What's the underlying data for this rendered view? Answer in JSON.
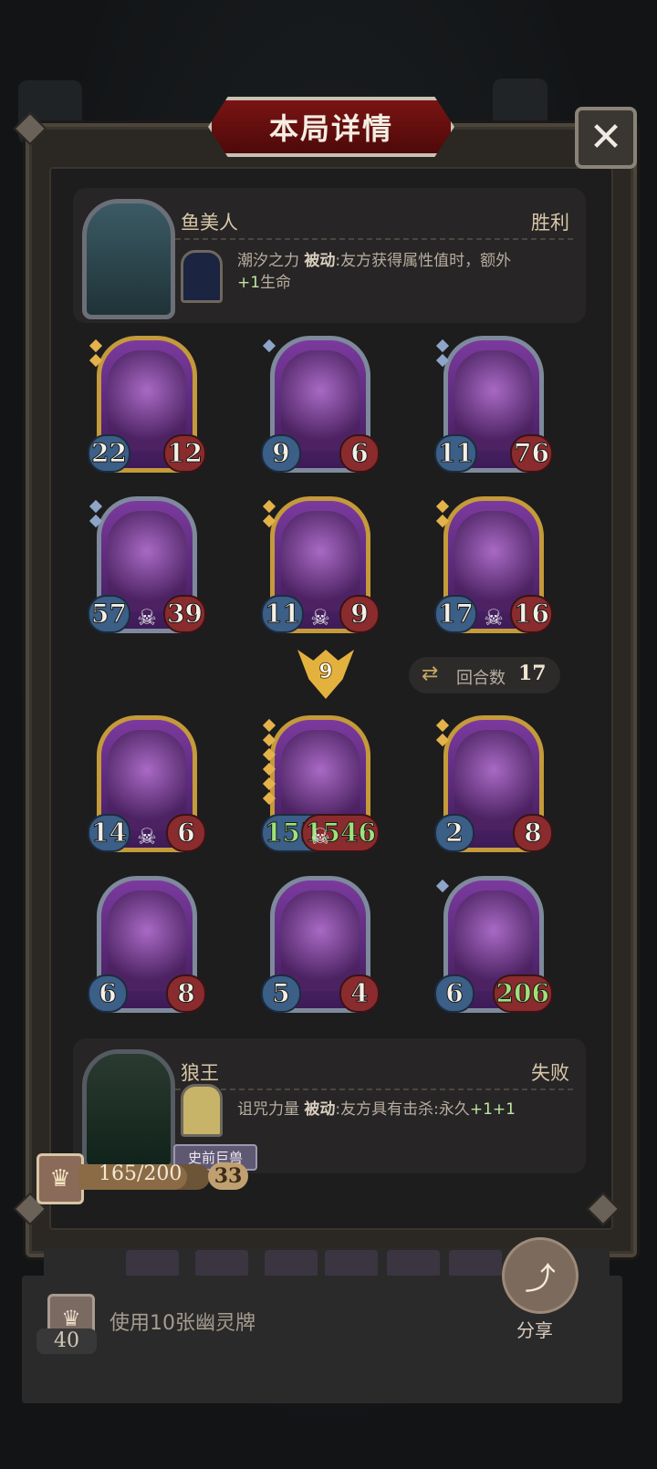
{
  "title": "本局详情",
  "close_label": "✕",
  "winner": {
    "name": "鱼美人",
    "result": "胜利",
    "skill_name": "潮汐之力",
    "skill_type": "被动",
    "skill_desc": ":友方获得属性值时，额外",
    "skill_desc2_bonus": "+1",
    "skill_desc2": "生命"
  },
  "loser": {
    "name": "狼王",
    "result": "失败",
    "skill_name": "诅咒力量",
    "skill_type": "被动",
    "skill_desc": ":友方具有击杀:永久",
    "skill_bonus": "+1+1",
    "tag": "史前巨兽"
  },
  "winner_board": [
    {
      "atk": "22",
      "hp": "12",
      "skull": false,
      "frame": "gold",
      "pips": 2
    },
    {
      "atk": "9",
      "hp": "6",
      "skull": false,
      "frame": "silver",
      "pips": 1
    },
    {
      "atk": "11",
      "hp": "76",
      "skull": false,
      "frame": "silver",
      "pips": 2
    },
    {
      "atk": "57",
      "hp": "39",
      "skull": true,
      "frame": "silver",
      "pips": 2
    },
    {
      "atk": "11",
      "hp": "9",
      "skull": true,
      "frame": "gold",
      "pips": 2
    },
    {
      "atk": "17",
      "hp": "16",
      "skull": true,
      "frame": "gold",
      "pips": 2
    }
  ],
  "loser_board": [
    {
      "atk": "14",
      "hp": "6",
      "skull": true,
      "frame": "gold",
      "pips": 0
    },
    {
      "atk": "1556",
      "hp": "1546",
      "skull": true,
      "frame": "gold",
      "pips": 6,
      "big": true
    },
    {
      "atk": "2",
      "hp": "8",
      "skull": false,
      "frame": "gold",
      "pips": 2
    },
    {
      "atk": "6",
      "hp": "8",
      "skull": false,
      "frame": "silver",
      "pips": 0
    },
    {
      "atk": "5",
      "hp": "4",
      "skull": false,
      "frame": "silver",
      "pips": 0
    },
    {
      "atk": "6",
      "hp": "206",
      "skull": false,
      "frame": "silver",
      "pips": 1,
      "big_hp": true
    }
  ],
  "turn_marker": "9",
  "rounds": {
    "label": "回合数",
    "value": "17",
    "icon": "swap-icon"
  },
  "level": {
    "xp_text": "165/200",
    "xp_fraction": 0.825,
    "level": "33",
    "icon": "crown-icon"
  },
  "footer": {
    "badge_value": "40",
    "quest_text": "使用10张幽灵牌",
    "share_label": "分享",
    "share_icon": "share-icon"
  },
  "colors": {
    "gold_frame": "#c49a3a",
    "silver_frame": "#7e8a9c",
    "title_red": "#7a1414",
    "turn_gold": "#e3b23e"
  }
}
